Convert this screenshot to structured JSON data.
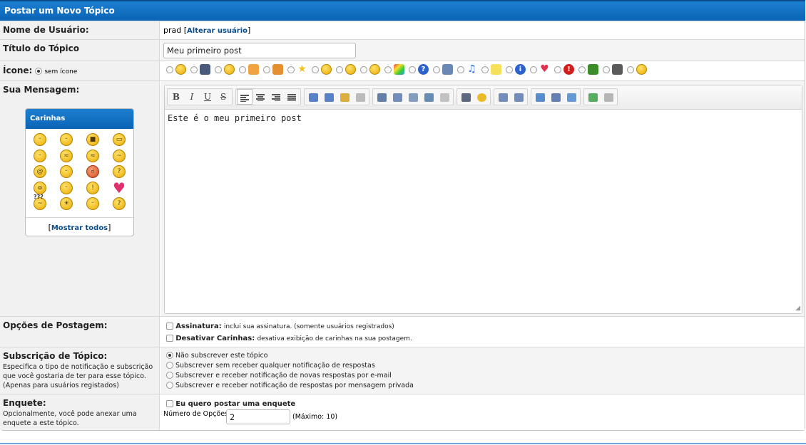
{
  "header": {
    "title": "Postar um Novo Tópico"
  },
  "username_row": {
    "label": "Nome de Usuário:",
    "value": "prad",
    "bracket_open": "[",
    "change_link": "Alterar usuário",
    "bracket_close": "]"
  },
  "title_row": {
    "label": "Título do Tópico",
    "value": "Meu primeiro post"
  },
  "icon_row": {
    "label": "Ícone:",
    "none_label": "sem ícone",
    "selected": "sem ícone",
    "icons": [
      "smile-icon",
      "film-icon",
      "grin-icon",
      "thumbs-up-icon",
      "thumbs-down-icon",
      "star-icon",
      "surprised-icon",
      "sad-icon",
      "wink-icon",
      "rainbow-icon",
      "question-icon",
      "image-icon",
      "music-icon",
      "lightbulb-icon",
      "info-icon",
      "heart-icon",
      "exclamation-icon",
      "bug-icon",
      "clapperboard-icon",
      "laugh-icon"
    ]
  },
  "message_row": {
    "label": "Sua Mensagem:",
    "editor_text": "Este é o meu primeiro post",
    "toolbar": {
      "bold": "B",
      "italic": "I",
      "underline": "U",
      "strike": "S",
      "groups": [
        [
          "bold",
          "italic",
          "underline",
          "strikethrough"
        ],
        [
          "align-left",
          "align-center",
          "align-right",
          "justify"
        ],
        [
          "font-icon",
          "font-size-icon",
          "color-icon",
          "remove-format-icon"
        ],
        [
          "horizontal-rule-icon",
          "table-icon",
          "email-icon",
          "link-icon",
          "unlink-icon"
        ],
        [
          "video-icon",
          "emoticon-icon"
        ],
        [
          "bullet-list-icon",
          "numbered-list-icon"
        ],
        [
          "quote-icon",
          "code-icon",
          "spoiler-icon"
        ],
        [
          "source-icon",
          "new-page-icon"
        ]
      ]
    },
    "smilies": {
      "title": "Carinhas",
      "show_all_open": "[",
      "show_all": "Mostrar todos",
      "show_all_close": "]",
      "faces": [
        {
          "glyph": "ᵕ",
          "style": "plain"
        },
        {
          "glyph": "ᵕ",
          "style": "plain"
        },
        {
          "glyph": "■",
          "style": "plain"
        },
        {
          "glyph": "▭",
          "style": "plain"
        },
        {
          "glyph": "ᵕ",
          "style": "plain"
        },
        {
          "glyph": "≈",
          "style": "plain"
        },
        {
          "glyph": "≈",
          "style": "plain"
        },
        {
          "glyph": "~",
          "style": "plain"
        },
        {
          "glyph": "@",
          "style": "plain"
        },
        {
          "glyph": "ᵕ",
          "style": "plain"
        },
        {
          "glyph": "ಠ",
          "style": "red"
        },
        {
          "glyph": "?",
          "style": "plain"
        },
        {
          "glyph": "ɷ",
          "style": "plain"
        },
        {
          "glyph": "ᵕ",
          "style": "plain"
        },
        {
          "glyph": "!",
          "style": "plain"
        },
        {
          "glyph": "♥",
          "style": "heart"
        },
        {
          "glyph": "~",
          "style": "plain"
        },
        {
          "glyph": "☀",
          "style": "plain"
        },
        {
          "glyph": "ᵕ",
          "style": "plain"
        },
        {
          "glyph": "?",
          "style": "plain"
        }
      ],
      "question_marks": "???"
    }
  },
  "posting_options": {
    "label": "Opções de Postagem:",
    "signature_bold": "Assinatura:",
    "signature_text": "inclui sua assinatura. (somente usuários registrados)",
    "disable_smilies_bold": "Desativar Carinhas:",
    "disable_smilies_text": "desativa exibição de carinhas na sua postagem."
  },
  "subscription": {
    "label": "Subscrição de Tópico:",
    "description": "Especifica o tipo de notificação e subscrição que você gostaria de ter para esse tópico. (Apenas para usuários registados)",
    "options": [
      "Não subscrever este tópico",
      "Subscrever sem receber qualquer notificação de respostas",
      "Subscrever e receber notificação de novas respostas por e-mail",
      "Subscrever e receber notificação de respostas por mensagem privada"
    ],
    "selected_index": 0
  },
  "poll": {
    "label": "Enquete:",
    "description": "Opcionalmente, você pode anexar uma enquete a este tópico.",
    "checkbox_label": "Eu quero postar uma enquete",
    "options_label": "Número de Opções:",
    "options_value": "2",
    "max_note": "(Máximo: 10)"
  },
  "colors": {
    "header_blue": "#0b64b6",
    "link": "#0a4d8c",
    "label_bg": "#f1f1f1"
  }
}
